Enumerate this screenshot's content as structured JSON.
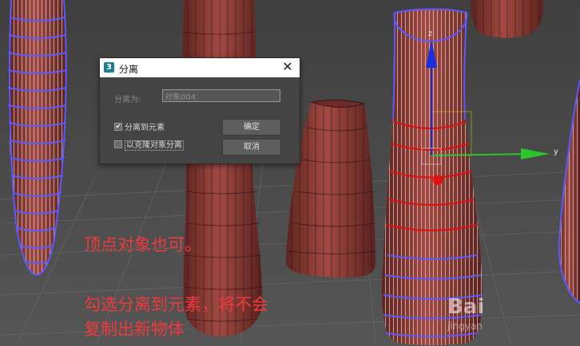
{
  "dialog": {
    "title": "分离",
    "app_icon": "3",
    "close_symbol": "✕",
    "name_label": "分离为:",
    "name_value": "对象004",
    "detach_to_element_label": "分离到元素",
    "detach_to_element_checked": true,
    "detach_as_clone_label": "以克隆对象分离",
    "detach_as_clone_checked": false,
    "ok_label": "确定",
    "cancel_label": "取消"
  },
  "captions": {
    "line1": "顶点对象也可。",
    "line2": "勾选分离到元素，将不会",
    "line3": "复制出新物体"
  },
  "gizmo": {
    "y_axis_label": "y",
    "z_axis_label": "z"
  },
  "watermark": {
    "brand": "Bai",
    "sub": "jingyan"
  },
  "colors": {
    "viewport_bg": "#4e4e4e",
    "mesh_fill": "#8e3c36",
    "mesh_wire": "#f0e0e0",
    "selection_blue": "#5a5aff",
    "selection_red": "#e01010",
    "axis_green": "#2cc52c",
    "axis_blue": "#1a2fe0",
    "caption_red": "#ef3b3b"
  }
}
